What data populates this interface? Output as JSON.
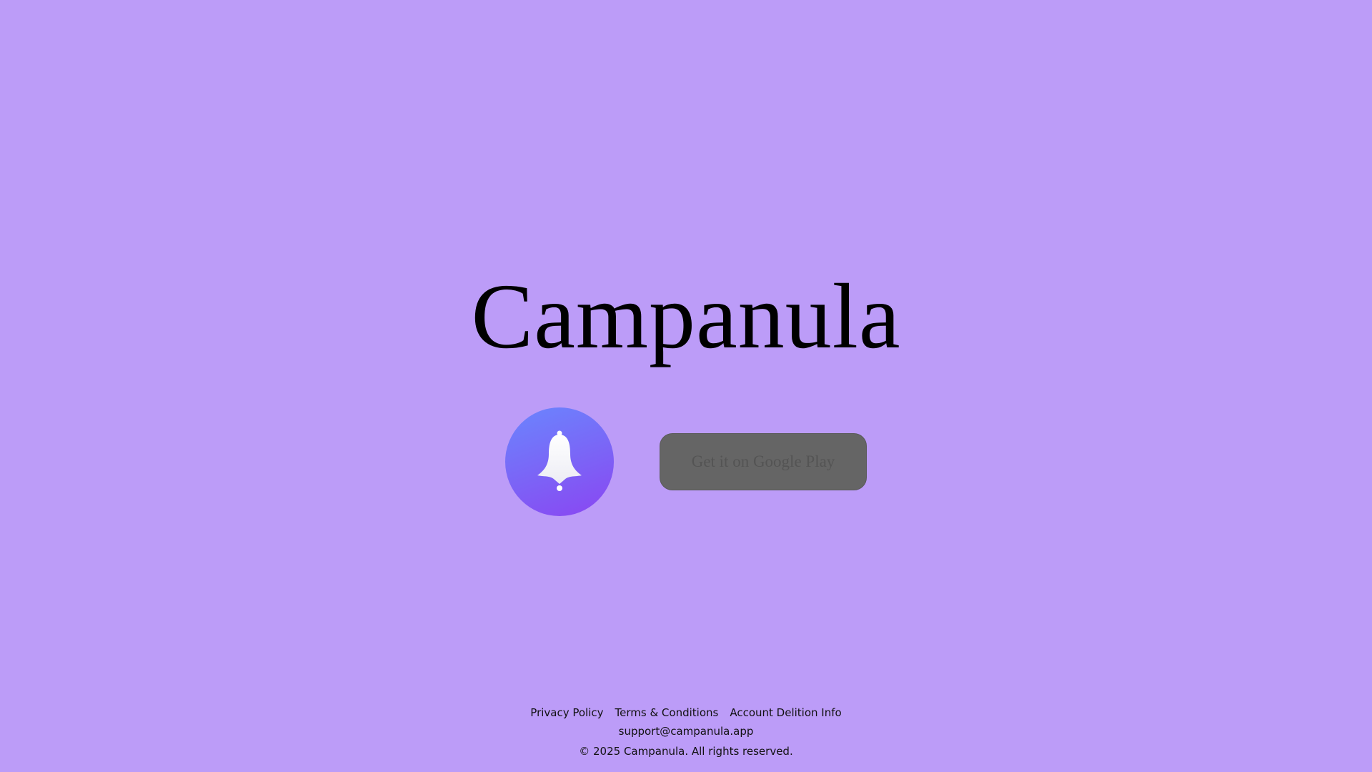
{
  "hero": {
    "title": "Campanula"
  },
  "app_icon": {
    "icon": "bell-icon",
    "gradient": [
      "#6a86fe",
      "#8a45f2"
    ]
  },
  "store_button": {
    "label": "Get it on Google Play"
  },
  "footer": {
    "links": [
      {
        "label": "Privacy Policy"
      },
      {
        "label": "Terms & Conditions"
      },
      {
        "label": "Account Delition Info"
      }
    ],
    "email": "support@campanula.app",
    "copyright": "© 2025 Campanula. All rights reserved."
  },
  "colors": {
    "background": "#bc9cf8",
    "button": "#656565"
  }
}
